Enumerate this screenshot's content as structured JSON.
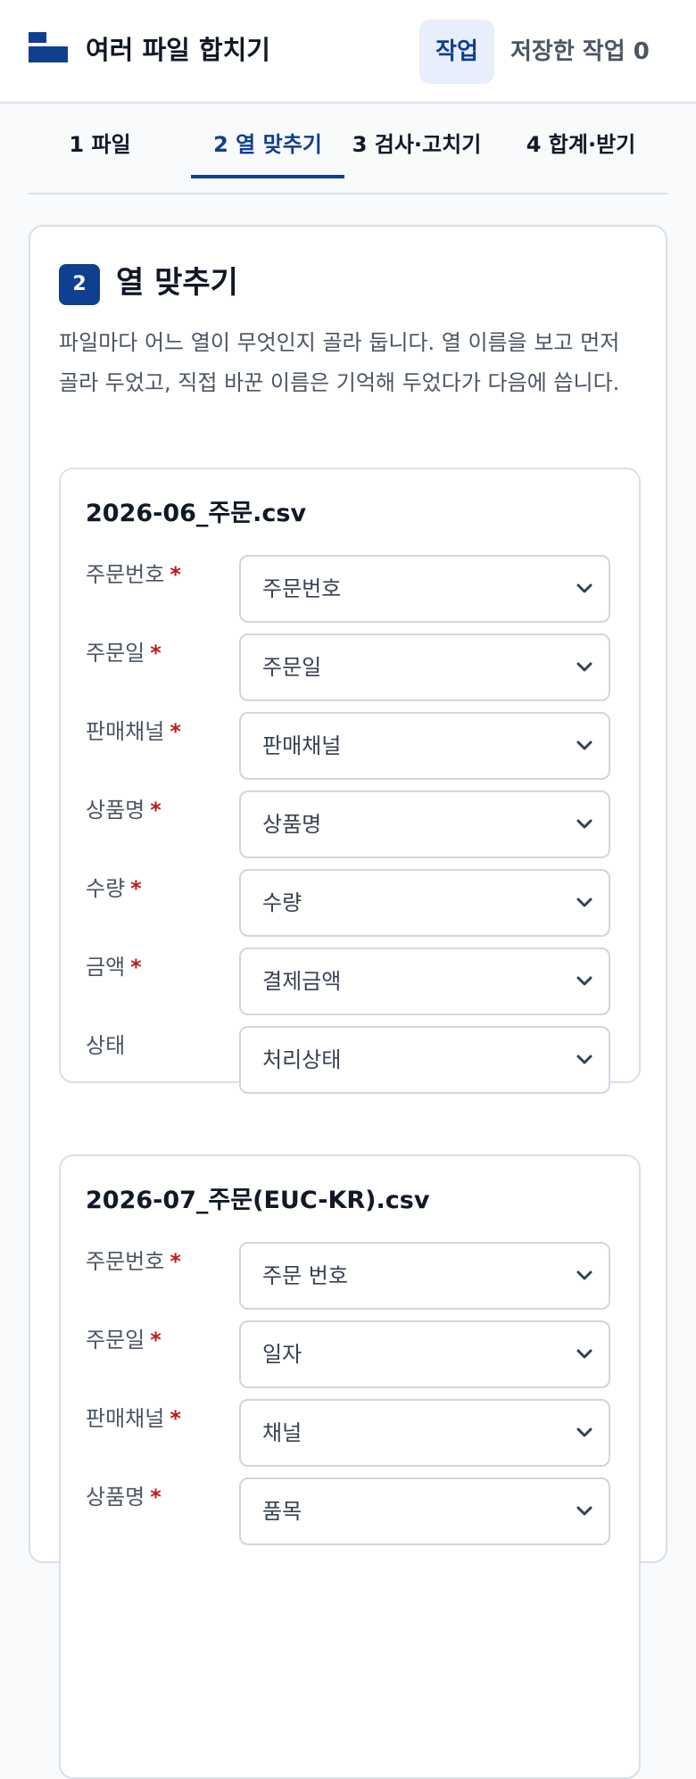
{
  "header": {
    "app_title": "여러 파일 합치기",
    "nav_work": "작업",
    "nav_saved": "저장한 작업 0",
    "logo_icon": "folder-stack-icon",
    "accent_color": "#0f3f8f"
  },
  "tabs": [
    {
      "label": "1 파일",
      "active": false
    },
    {
      "label": "2 열 맞추기",
      "active": true
    },
    {
      "label": "3 검사·고치기",
      "active": false
    },
    {
      "label": "4 합계·받기",
      "active": false
    }
  ],
  "section": {
    "step": "2",
    "title": "열 맞추기",
    "description": "파일마다 어느 열이 무엇인지 골라 둡니다. 열 이름을 보고 먼저 골라 두었고, 직접 바꾼 이름은 기억해 두었다가 다음에 씁니다."
  },
  "files": [
    {
      "name": "2026-06_주문.csv",
      "mappings": [
        {
          "field": "주문번호",
          "required": true,
          "selected": "주문번호"
        },
        {
          "field": "주문일",
          "required": true,
          "selected": "주문일"
        },
        {
          "field": "판매채널",
          "required": true,
          "selected": "판매채널"
        },
        {
          "field": "상품명",
          "required": true,
          "selected": "상품명"
        },
        {
          "field": "수량",
          "required": true,
          "selected": "수량"
        },
        {
          "field": "금액",
          "required": true,
          "selected": "결제금액"
        },
        {
          "field": "상태",
          "required": false,
          "selected": "처리상태"
        }
      ]
    },
    {
      "name": "2026-07_주문(EUC-KR).csv",
      "mappings": [
        {
          "field": "주문번호",
          "required": true,
          "selected": "주문 번호"
        },
        {
          "field": "주문일",
          "required": true,
          "selected": "일자"
        },
        {
          "field": "판매채널",
          "required": true,
          "selected": "채널"
        },
        {
          "field": "상품명",
          "required": true,
          "selected": "품목"
        }
      ]
    }
  ],
  "required_marker": "*",
  "required_color": "#b91c1c"
}
